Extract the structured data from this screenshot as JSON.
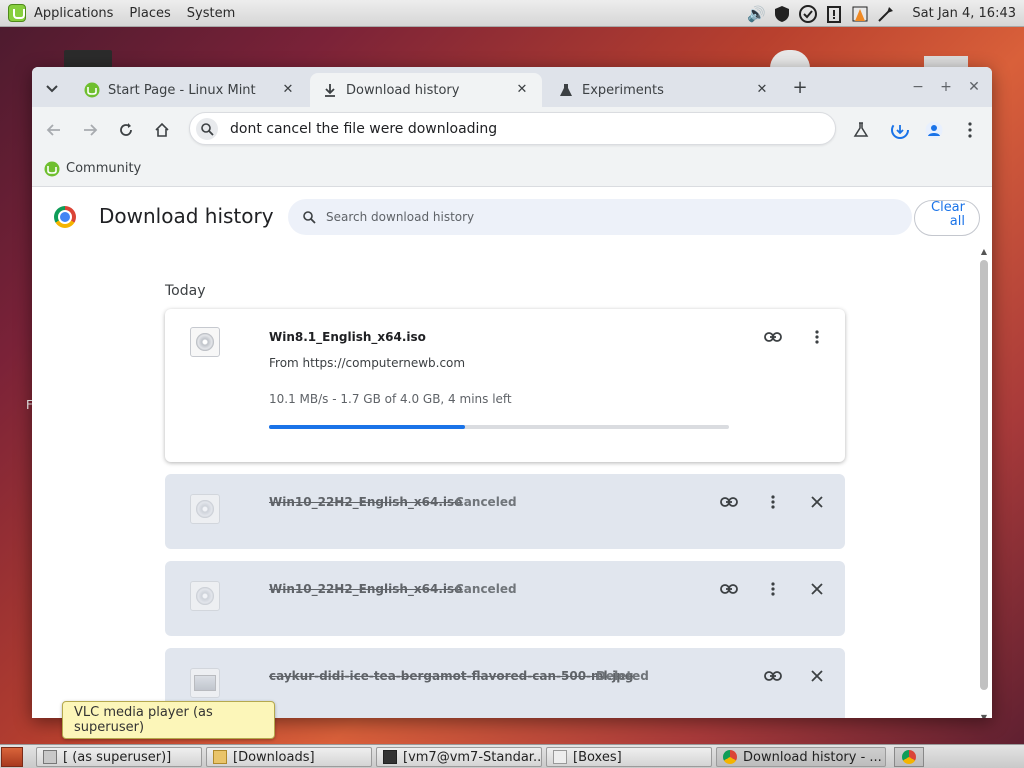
{
  "top_panel": {
    "menus": [
      "Applications",
      "Places",
      "System"
    ],
    "clock": "Sat Jan  4, 16:43"
  },
  "browser": {
    "tabs": [
      {
        "label": "Start Page - Linux Mint",
        "icon": "mint-icon"
      },
      {
        "label": "Download history",
        "icon": "download-icon"
      },
      {
        "label": "Experiments",
        "icon": "flask-icon"
      }
    ],
    "omnibox_text": "dont cancel the file were downloading",
    "bookmarks": [
      {
        "label": "Community"
      }
    ]
  },
  "page": {
    "title": "Download history",
    "search_placeholder": "Search download history",
    "clear_all_line1": "Clear",
    "clear_all_line2": "all",
    "section_today": "Today",
    "downloads": [
      {
        "name": "Win8.1_English_x64.iso",
        "from": "From https://computernewb.com",
        "progress_text": "10.1 MB/s - 1.7 GB of 4.0 GB, 4 mins left",
        "progress": 0.425,
        "state": "in_progress"
      },
      {
        "name": "Win10_22H2_English_x64.iso",
        "status": "Canceled",
        "state": "canceled"
      },
      {
        "name": "Win10_22H2_English_x64.iso",
        "status": "Canceled",
        "state": "canceled"
      },
      {
        "name": "caykur-didi-ice-tea-bergamot-flavored-can-500-ml.jpg",
        "status": "Deleted",
        "state": "deleted"
      }
    ]
  },
  "tooltip": "VLC media player (as superuser)",
  "taskbar": {
    "items": [
      {
        "label": "[ (as superuser)]"
      },
      {
        "label": "[Downloads]"
      },
      {
        "label": "[vm7@vm7-Standar..."
      },
      {
        "label": "[Boxes]"
      },
      {
        "label": "Download history - ..."
      }
    ]
  },
  "colors": {
    "accent": "#1a73e8",
    "card_done_bg": "#e1e6ee",
    "tooltip_bg": "#fcf6b9"
  }
}
